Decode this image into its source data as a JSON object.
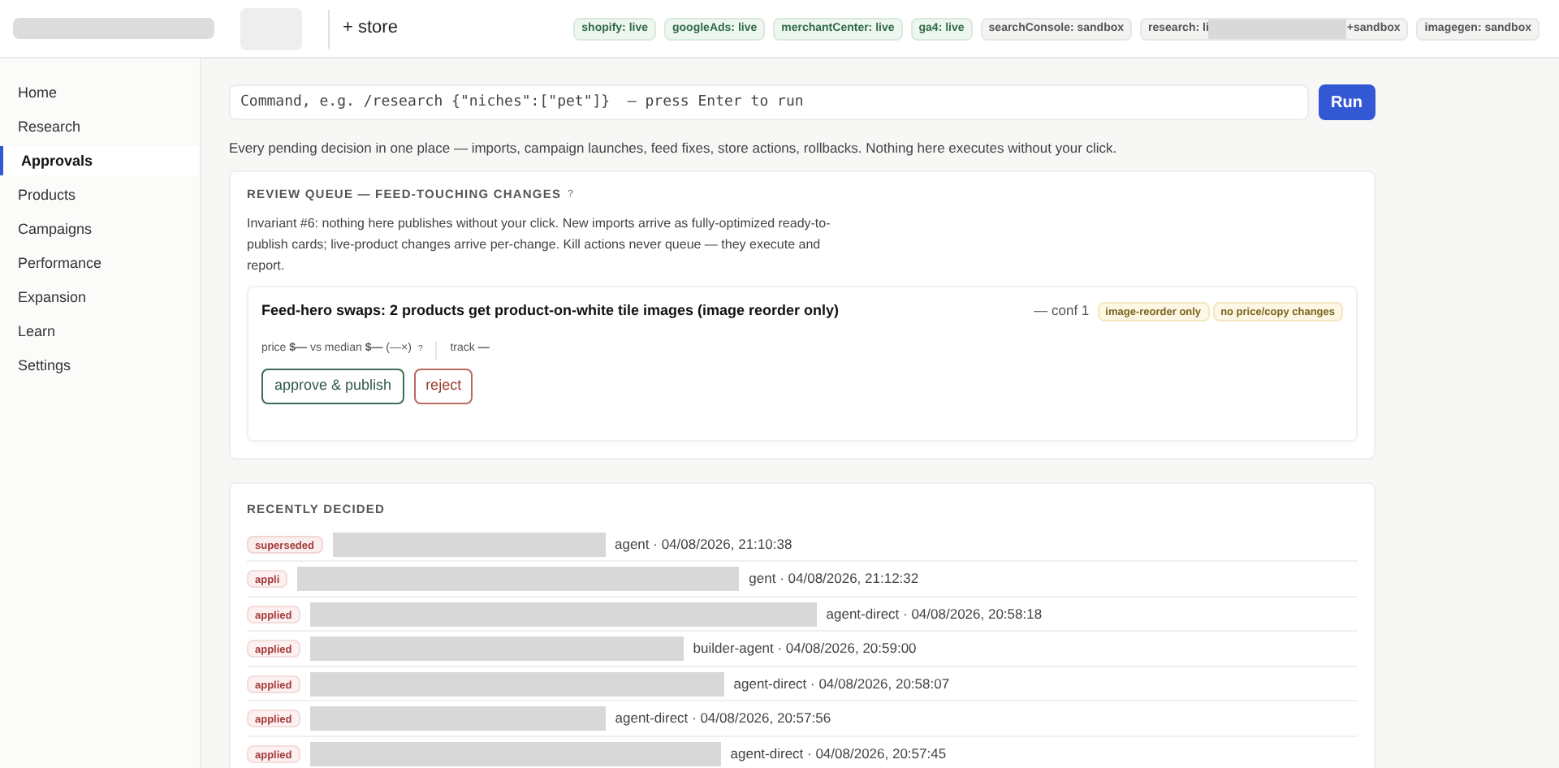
{
  "header": {
    "store_link": "+ store",
    "integrations": [
      {
        "label": "shopify: live",
        "live": true
      },
      {
        "label": "googleAds: live",
        "live": true
      },
      {
        "label": "merchantCenter: live",
        "live": true
      },
      {
        "label": "ga4: live",
        "live": true
      },
      {
        "label": "searchConsole: sandbox",
        "live": false
      },
      {
        "label": "research: li",
        "suffix": "+sandbox",
        "live": false,
        "redacted": true
      },
      {
        "label": "imagegen: sandbox",
        "live": false
      }
    ]
  },
  "sidebar": {
    "items": [
      {
        "label": "Home",
        "selected": false
      },
      {
        "label": "Research",
        "selected": false
      },
      {
        "label": "Approvals",
        "selected": true
      },
      {
        "label": "Products",
        "selected": false
      },
      {
        "label": "Campaigns",
        "selected": false
      },
      {
        "label": "Performance",
        "selected": false
      },
      {
        "label": "Expansion",
        "selected": false
      },
      {
        "label": "Learn",
        "selected": false
      },
      {
        "label": "Settings",
        "selected": false
      }
    ]
  },
  "command": {
    "placeholder": "Command, e.g. /research {\"niches\":[\"pet\"]}  — press Enter to run",
    "button": "Run"
  },
  "intro": "Every pending decision in one place — imports, campaign launches, feed fixes, store actions, rollbacks. Nothing here executes without your click.",
  "review_queue": {
    "title": "REVIEW QUEUE — FEED-TOUCHING CHANGES",
    "help": "?",
    "description": "Invariant #6: nothing here publishes without your click. New imports arrive as fully-optimized ready-to-publish cards; live-product changes arrive per-change. Kill actions never queue — they execute and report.",
    "cards": [
      {
        "title": "Feed-hero swaps: 2 products get product-on-white tile images (image reorder only)",
        "conf": "— conf 1",
        "tags": [
          "image-reorder only",
          "no price/copy changes"
        ],
        "price": "price **$—** vs median **$—** (—×)",
        "help": "?",
        "track": "track **—**",
        "approve": "approve & publish",
        "reject": "reject"
      }
    ]
  },
  "recently_decided": {
    "title": "RECENTLY DECIDED",
    "rows": [
      {
        "status": "superseded",
        "meta": "agent · 04/08/2026, 21:10:38"
      },
      {
        "status": "appli",
        "meta": "gent · 04/08/2026, 21:12:32"
      },
      {
        "status": "applied",
        "meta": "agent-direct · 04/08/2026, 20:58:18"
      },
      {
        "status": "applied",
        "meta": "builder-agent · 04/08/2026, 20:59:00"
      },
      {
        "status": "applied",
        "meta": "agent-direct · 04/08/2026, 20:58:07"
      },
      {
        "status": "applied",
        "meta": "agent-direct · 04/08/2026, 20:57:56"
      },
      {
        "status": "applied",
        "meta": "agent-direct · 04/08/2026, 20:57:45"
      }
    ]
  }
}
